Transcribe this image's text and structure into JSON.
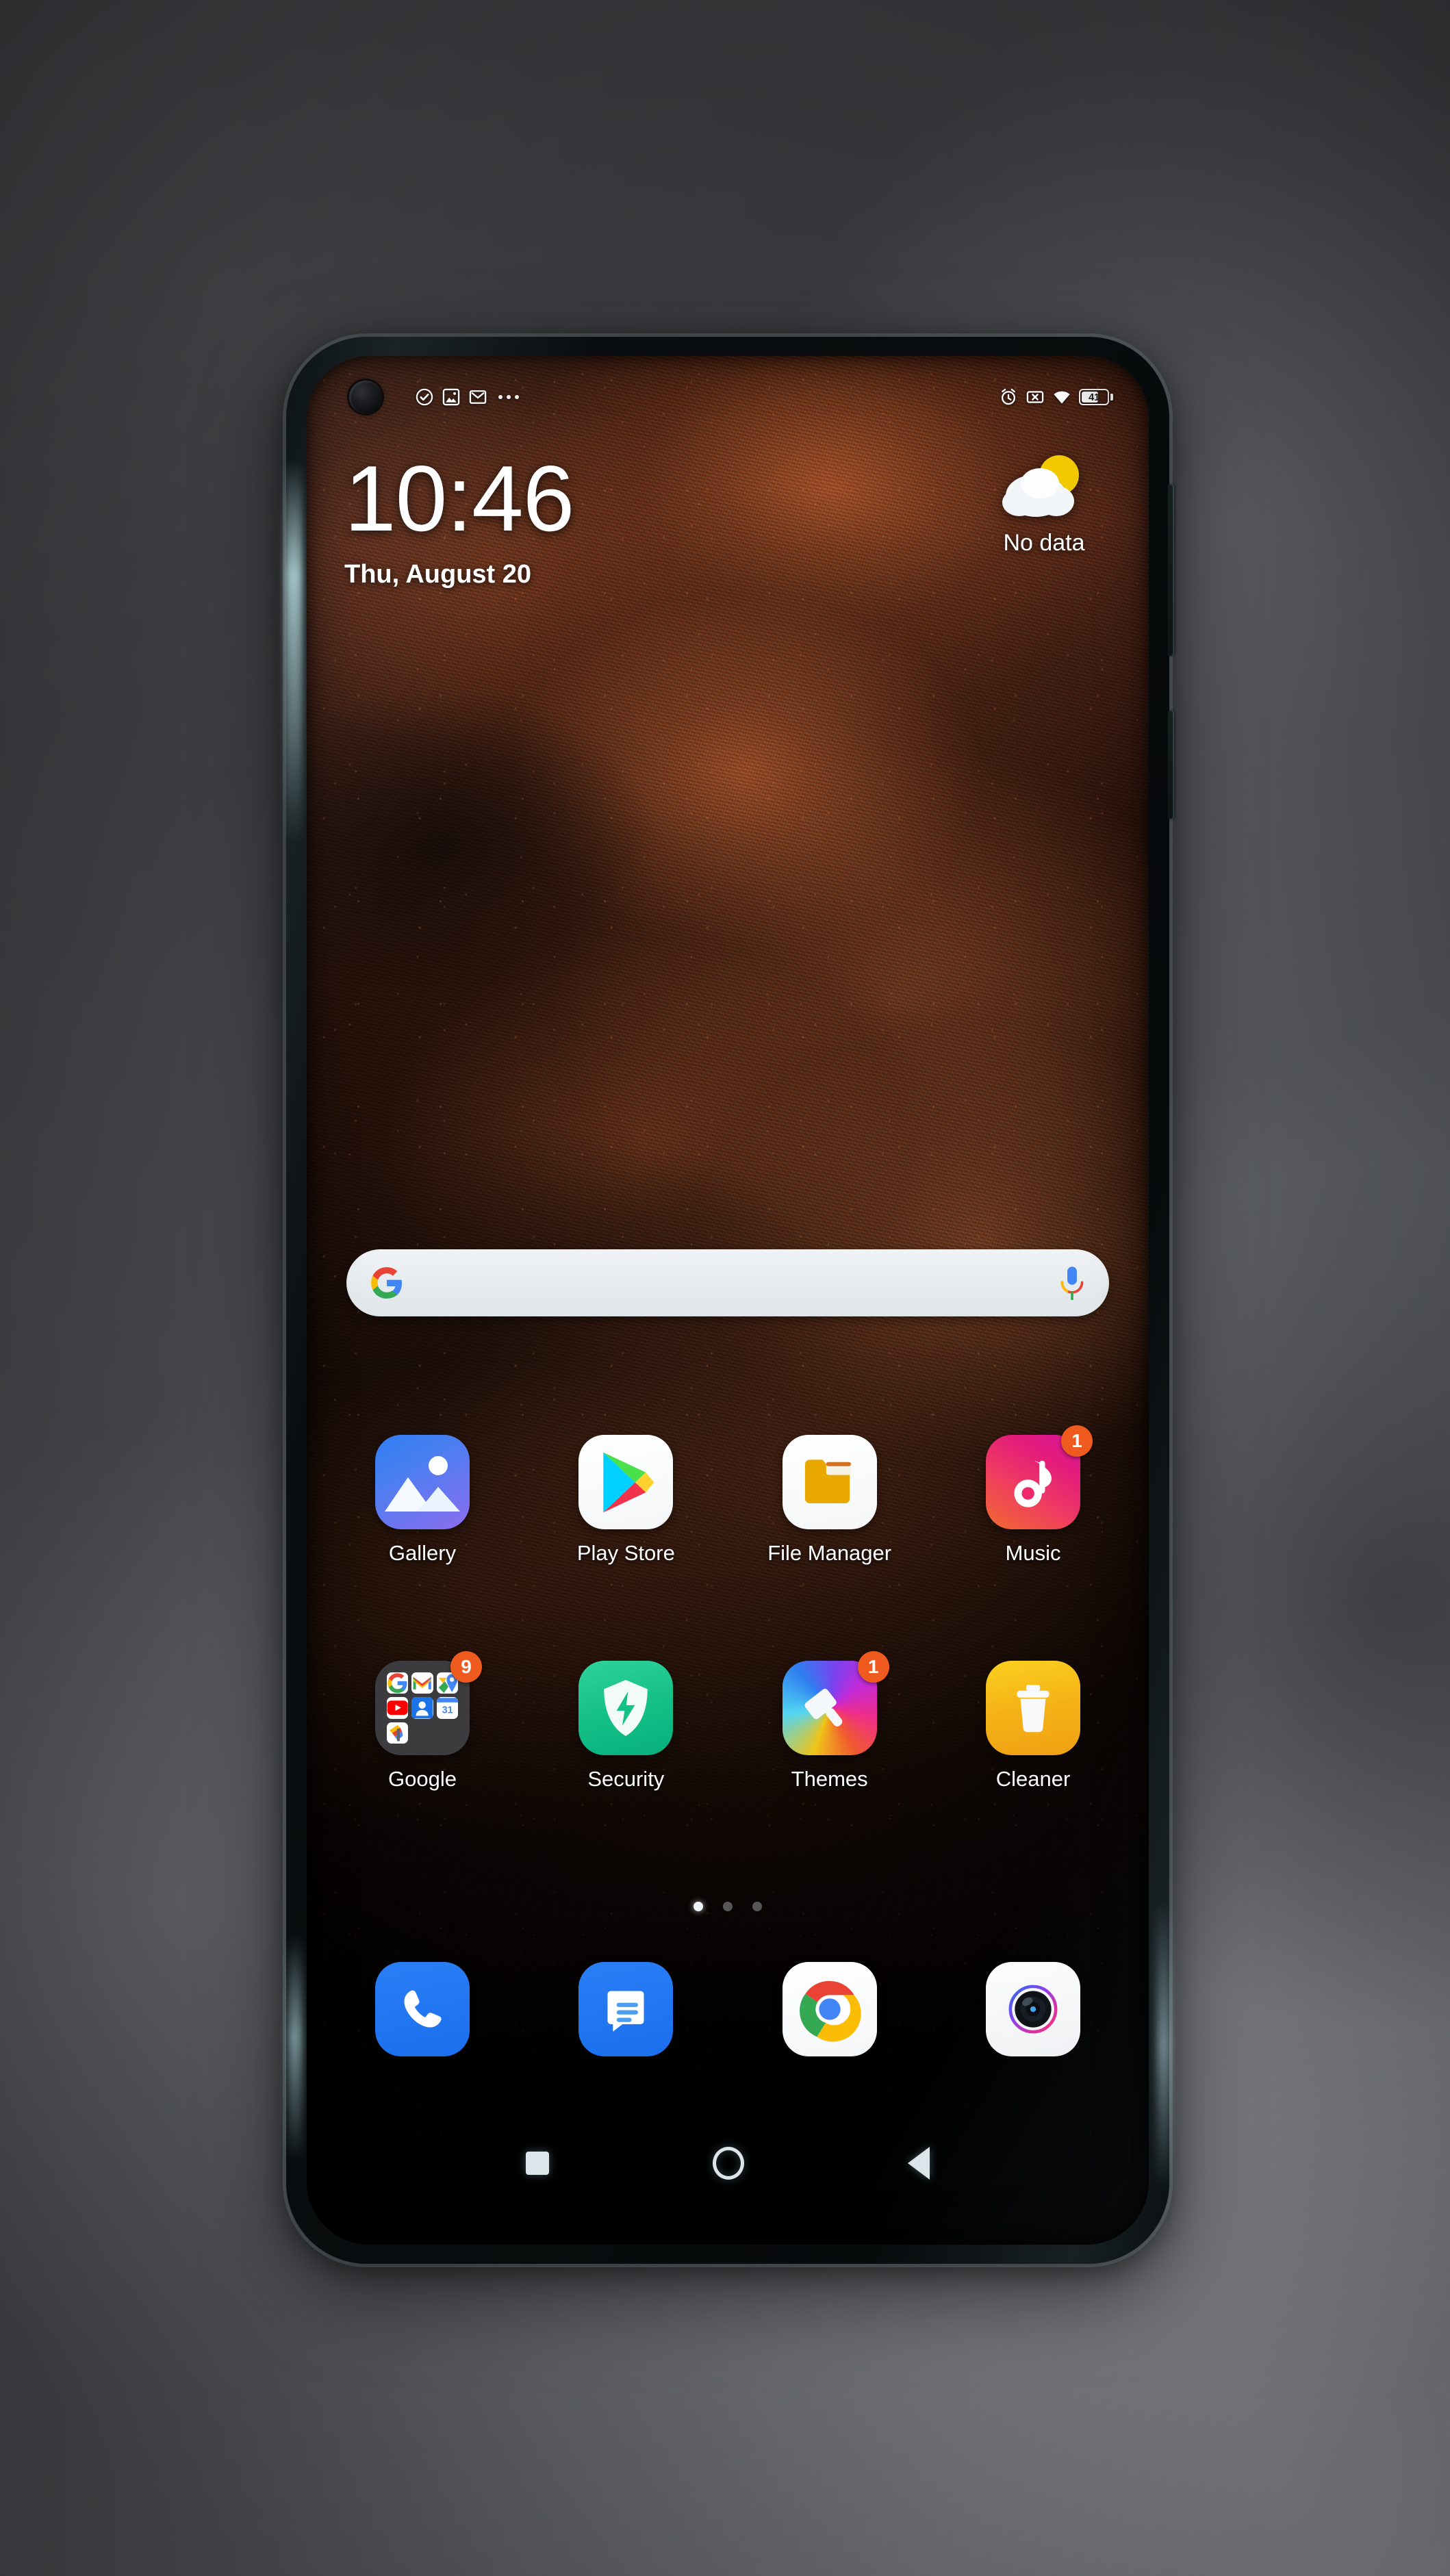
{
  "status_bar": {
    "left_icons": [
      {
        "name": "task-complete-icon",
        "glyph": "check-circle"
      },
      {
        "name": "photos-notification-icon",
        "glyph": "photos"
      },
      {
        "name": "gmail-notification-icon",
        "glyph": "gmail"
      },
      {
        "name": "more-notifications-icon",
        "glyph": "ellipsis"
      }
    ],
    "right_icons": [
      {
        "name": "alarm-icon",
        "glyph": "alarm"
      },
      {
        "name": "no-sim-icon",
        "glyph": "sim-x"
      },
      {
        "name": "wifi-icon",
        "glyph": "wifi"
      }
    ],
    "battery_level": "41"
  },
  "clock_widget": {
    "time": "10:46",
    "date": "Thu, August 20"
  },
  "weather_widget": {
    "icon": "sun-behind-cloud-icon",
    "status": "No data"
  },
  "search": {
    "placeholder": "",
    "value": "",
    "left_icon": "google-g-icon",
    "right_icon": "microphone-icon"
  },
  "home_screen": {
    "rows": [
      {
        "apps": [
          {
            "label": "Gallery",
            "icon": "gallery-icon",
            "badge": null
          },
          {
            "label": "Play Store",
            "icon": "play-store-icon",
            "badge": null
          },
          {
            "label": "File Manager",
            "icon": "file-manager-icon",
            "badge": null
          },
          {
            "label": "Music",
            "icon": "music-icon",
            "badge": "1"
          }
        ]
      },
      {
        "apps": [
          {
            "label": "Google",
            "icon": "google-folder-icon",
            "badge": "9"
          },
          {
            "label": "Security",
            "icon": "security-icon",
            "badge": null
          },
          {
            "label": "Themes",
            "icon": "themes-icon",
            "badge": "1"
          },
          {
            "label": "Cleaner",
            "icon": "cleaner-icon",
            "badge": null
          }
        ]
      }
    ],
    "google_folder_contents": [
      "google-search-icon",
      "gmail-icon",
      "maps-icon",
      "youtube-icon",
      "contacts-icon",
      "calendar-icon",
      "google-one-icon"
    ],
    "page_indicator": {
      "total": 3,
      "active": 1
    }
  },
  "dock": {
    "apps": [
      {
        "label": "Phone",
        "icon": "phone-icon"
      },
      {
        "label": "Messages",
        "icon": "messages-icon"
      },
      {
        "label": "Chrome",
        "icon": "chrome-icon"
      },
      {
        "label": "Camera",
        "icon": "camera-icon"
      }
    ]
  },
  "navigation_bar": {
    "buttons": [
      {
        "name": "recents-button",
        "icon": "square-icon"
      },
      {
        "name": "home-button",
        "icon": "circle-icon"
      },
      {
        "name": "back-button",
        "icon": "triangle-left-icon"
      }
    ]
  },
  "device": {
    "hardware_buttons": [
      {
        "name": "volume-rocker",
        "side": "right"
      },
      {
        "name": "power-button",
        "side": "right"
      }
    ],
    "front_camera": "punch-hole-camera"
  },
  "colors": {
    "badge": "#ef5a1e",
    "accent_blue": "#1a73e8",
    "search_bg": "#e7ecef",
    "label_text": "#ffffff"
  }
}
